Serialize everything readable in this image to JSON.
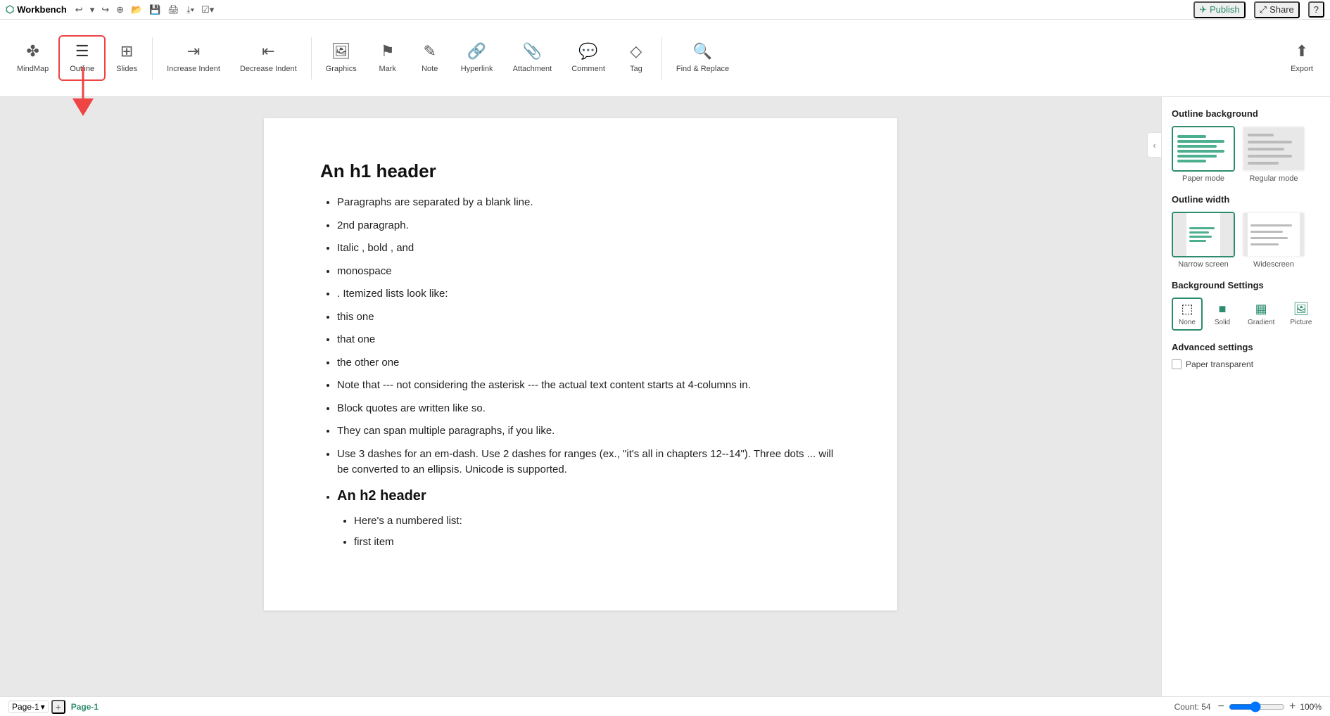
{
  "app": {
    "title": "Workbench"
  },
  "topbar": {
    "publish": "Publish",
    "share": "Share",
    "help": "?"
  },
  "toolbar": {
    "mindmap_label": "MindMap",
    "outline_label": "Outline",
    "slides_label": "Slides",
    "increase_indent_label": "Increase Indent",
    "decrease_indent_label": "Decrease Indent",
    "graphics_label": "Graphics",
    "mark_label": "Mark",
    "note_label": "Note",
    "hyperlink_label": "Hyperlink",
    "attachment_label": "Attachment",
    "comment_label": "Comment",
    "tag_label": "Tag",
    "find_replace_label": "Find & Replace",
    "export_label": "Export"
  },
  "document": {
    "h1": "An h1 header",
    "bullets": [
      "Paragraphs are separated by a blank line.",
      "2nd paragraph.",
      "Italic , bold , and",
      "monospace",
      ". Itemized lists look like:",
      "this one",
      "that one",
      "the other one",
      "Note that --- not considering the asterisk --- the actual text content starts at 4-columns in.",
      "Block quotes are written like so.",
      "They can span multiple paragraphs, if you like.",
      "Use 3 dashes for an em-dash. Use 2 dashes for ranges (ex., \"it's all in chapters 12--14\"). Three dots ... will be converted to an ellipsis. Unicode is supported."
    ],
    "h2": "An h2 header",
    "sub_bullets": [
      "Here's a numbered list:",
      "first item"
    ]
  },
  "right_panel": {
    "outline_background_title": "Outline background",
    "paper_mode_label": "Paper mode",
    "regular_mode_label": "Regular mode",
    "outline_width_title": "Outline width",
    "narrow_screen_label": "Narrow screen",
    "widescreen_label": "Widescreen",
    "background_settings_title": "Background Settings",
    "none_label": "None",
    "solid_label": "Solid",
    "gradient_label": "Gradient",
    "picture_label": "Picture",
    "advanced_settings_title": "Advanced settings",
    "paper_transparent_label": "Paper transparent"
  },
  "bottombar": {
    "page_name": "Page-1",
    "page_tab": "Page-1",
    "count_label": "Count: 54",
    "zoom_level": "100%"
  }
}
